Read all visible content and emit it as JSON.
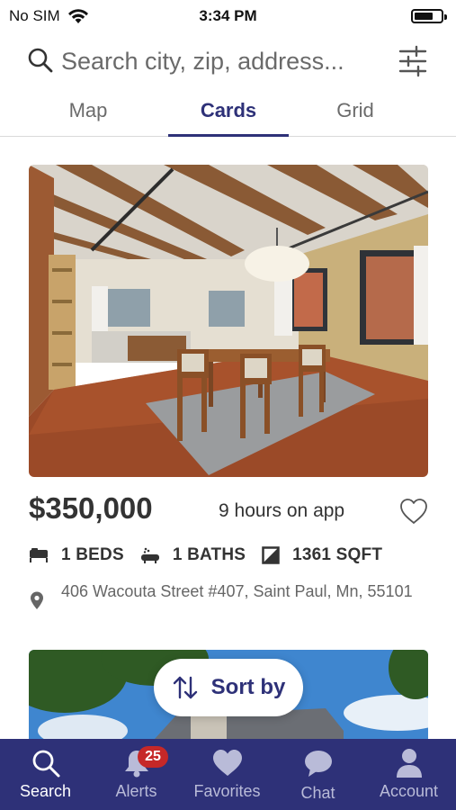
{
  "status_bar": {
    "carrier": "No SIM",
    "time": "3:34 PM"
  },
  "search": {
    "placeholder": "Search city, zip, address..."
  },
  "tabs": [
    {
      "label": "Map",
      "active": false
    },
    {
      "label": "Cards",
      "active": true
    },
    {
      "label": "Grid",
      "active": false
    }
  ],
  "listing": {
    "price": "$350,000",
    "time_on_app": "9 hours on app",
    "beds": "1 BEDS",
    "baths": "1 BATHS",
    "sqft": "1361 SQFT",
    "address": "406 Wacouta Street #407, Saint Paul, Mn, 55101"
  },
  "sort": {
    "label": "Sort by"
  },
  "bottom_nav": {
    "items": [
      {
        "label": "Search",
        "icon": "search-icon",
        "active": true
      },
      {
        "label": "Alerts",
        "icon": "bell-icon",
        "badge": "25"
      },
      {
        "label": "Favorites",
        "icon": "heart-icon"
      },
      {
        "label": "Chat",
        "icon": "chat-bubble-icon"
      },
      {
        "label": "Account",
        "icon": "person-icon"
      }
    ]
  },
  "colors": {
    "brand": "#2e3178",
    "badge": "#c62828"
  }
}
